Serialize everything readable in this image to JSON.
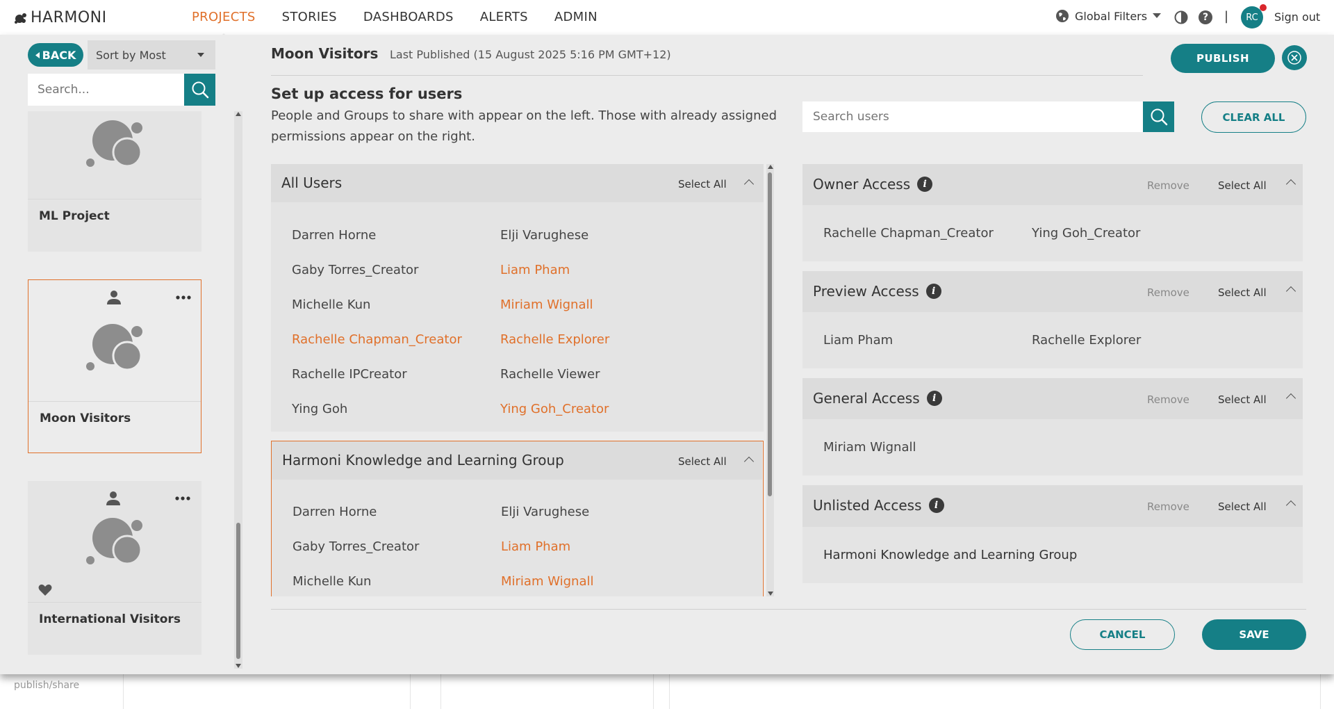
{
  "brand": {
    "name": "HARMONI"
  },
  "nav": {
    "items": [
      {
        "label": "PROJECTS",
        "active": true
      },
      {
        "label": "STORIES",
        "active": false
      },
      {
        "label": "DASHBOARDS",
        "active": false
      },
      {
        "label": "ALERTS",
        "active": false
      },
      {
        "label": "ADMIN",
        "active": false
      }
    ]
  },
  "topright": {
    "global_filters": "Global Filters",
    "separator": "|",
    "avatar_initials": "RC",
    "sign_out": "Sign out"
  },
  "sidebar": {
    "back_label": "BACK",
    "sort_value": "Sort by Most",
    "search_placeholder": "Search...",
    "cards": [
      {
        "title": "ML Project",
        "selected": false
      },
      {
        "title": "Moon Visitors",
        "selected": true
      },
      {
        "title": "International Visitors",
        "selected": false
      }
    ]
  },
  "header": {
    "project_title": "Moon Visitors",
    "last_published": "Last Published (15 August 2025 5:16 PM GMT+12)",
    "publish_label": "PUBLISH"
  },
  "setup": {
    "heading": "Set up access for users",
    "description": "People and Groups to share with appear on the left. Those with already assigned permissions appear on the right.",
    "search_placeholder": "Search users",
    "clear_all_label": "CLEAR ALL"
  },
  "groups": [
    {
      "name": "All Users",
      "select_all": "Select All",
      "members": [
        {
          "name": "Darren Horne",
          "highlight": false
        },
        {
          "name": "Elji Varughese",
          "highlight": false
        },
        {
          "name": "Gaby Torres_Creator",
          "highlight": false
        },
        {
          "name": "Liam Pham",
          "highlight": true
        },
        {
          "name": "Michelle Kun",
          "highlight": false
        },
        {
          "name": "Miriam Wignall",
          "highlight": true
        },
        {
          "name": "Rachelle Chapman_Creator",
          "highlight": true
        },
        {
          "name": "Rachelle Explorer",
          "highlight": true
        },
        {
          "name": "Rachelle IPCreator",
          "highlight": false
        },
        {
          "name": "Rachelle Viewer",
          "highlight": false
        },
        {
          "name": "Ying Goh",
          "highlight": false
        },
        {
          "name": "Ying Goh_Creator",
          "highlight": true
        }
      ]
    },
    {
      "name": "Harmoni Knowledge and Learning Group",
      "select_all": "Select All",
      "members": [
        {
          "name": "Darren Horne",
          "highlight": false
        },
        {
          "name": "Elji Varughese",
          "highlight": false
        },
        {
          "name": "Gaby Torres_Creator",
          "highlight": false
        },
        {
          "name": "Liam Pham",
          "highlight": true
        },
        {
          "name": "Michelle Kun",
          "highlight": false
        },
        {
          "name": "Miriam Wignall",
          "highlight": true
        }
      ]
    }
  ],
  "access": [
    {
      "name": "Owner Access",
      "remove": "Remove",
      "select_all": "Select All",
      "members": [
        "Rachelle Chapman_Creator",
        "Ying Goh_Creator"
      ],
      "bold": false
    },
    {
      "name": "Preview Access",
      "remove": "Remove",
      "select_all": "Select All",
      "members": [
        "Liam Pham",
        "Rachelle Explorer"
      ],
      "bold": false
    },
    {
      "name": "General Access",
      "remove": "Remove",
      "select_all": "Select All",
      "members": [
        "Miriam Wignall"
      ],
      "bold": false
    },
    {
      "name": "Unlisted Access",
      "remove": "Remove",
      "select_all": "Select All",
      "members": [
        "Harmoni Knowledge and Learning Group"
      ],
      "bold": true
    }
  ],
  "footer": {
    "cancel_label": "CANCEL",
    "save_label": "SAVE"
  },
  "underlay": {
    "text": "publish/share"
  },
  "colors": {
    "accent": "#157f86",
    "highlight": "#e0702a",
    "notification": "#d9262c"
  }
}
